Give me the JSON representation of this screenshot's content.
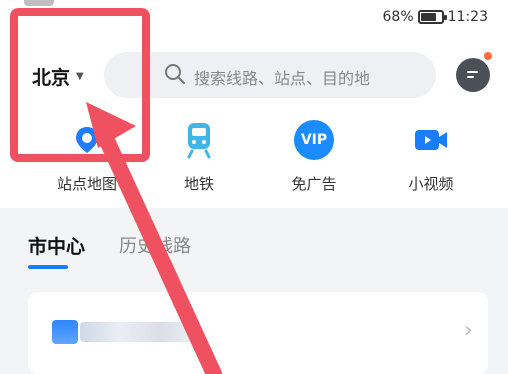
{
  "status": {
    "battery": "68%",
    "battery_level": 0.68,
    "time": "11:23"
  },
  "city": {
    "name": "北京"
  },
  "search": {
    "placeholder": "搜索线路、站点、目的地"
  },
  "quick_actions": [
    {
      "label": "站点地图",
      "icon": "map-pin-icon"
    },
    {
      "label": "地铁",
      "icon": "subway-icon"
    },
    {
      "label": "免广告",
      "icon": "vip-icon",
      "badge": "VIP"
    },
    {
      "label": "小视频",
      "icon": "video-camera-icon"
    }
  ],
  "tabs": [
    {
      "label": "市中心",
      "active": true
    },
    {
      "label": "历史线路",
      "active": false
    }
  ],
  "card": {
    "chevron": "›"
  },
  "colors": {
    "accent": "#1a7cff",
    "highlight": "#ef5160",
    "badge_dot": "#ff6b3d"
  }
}
